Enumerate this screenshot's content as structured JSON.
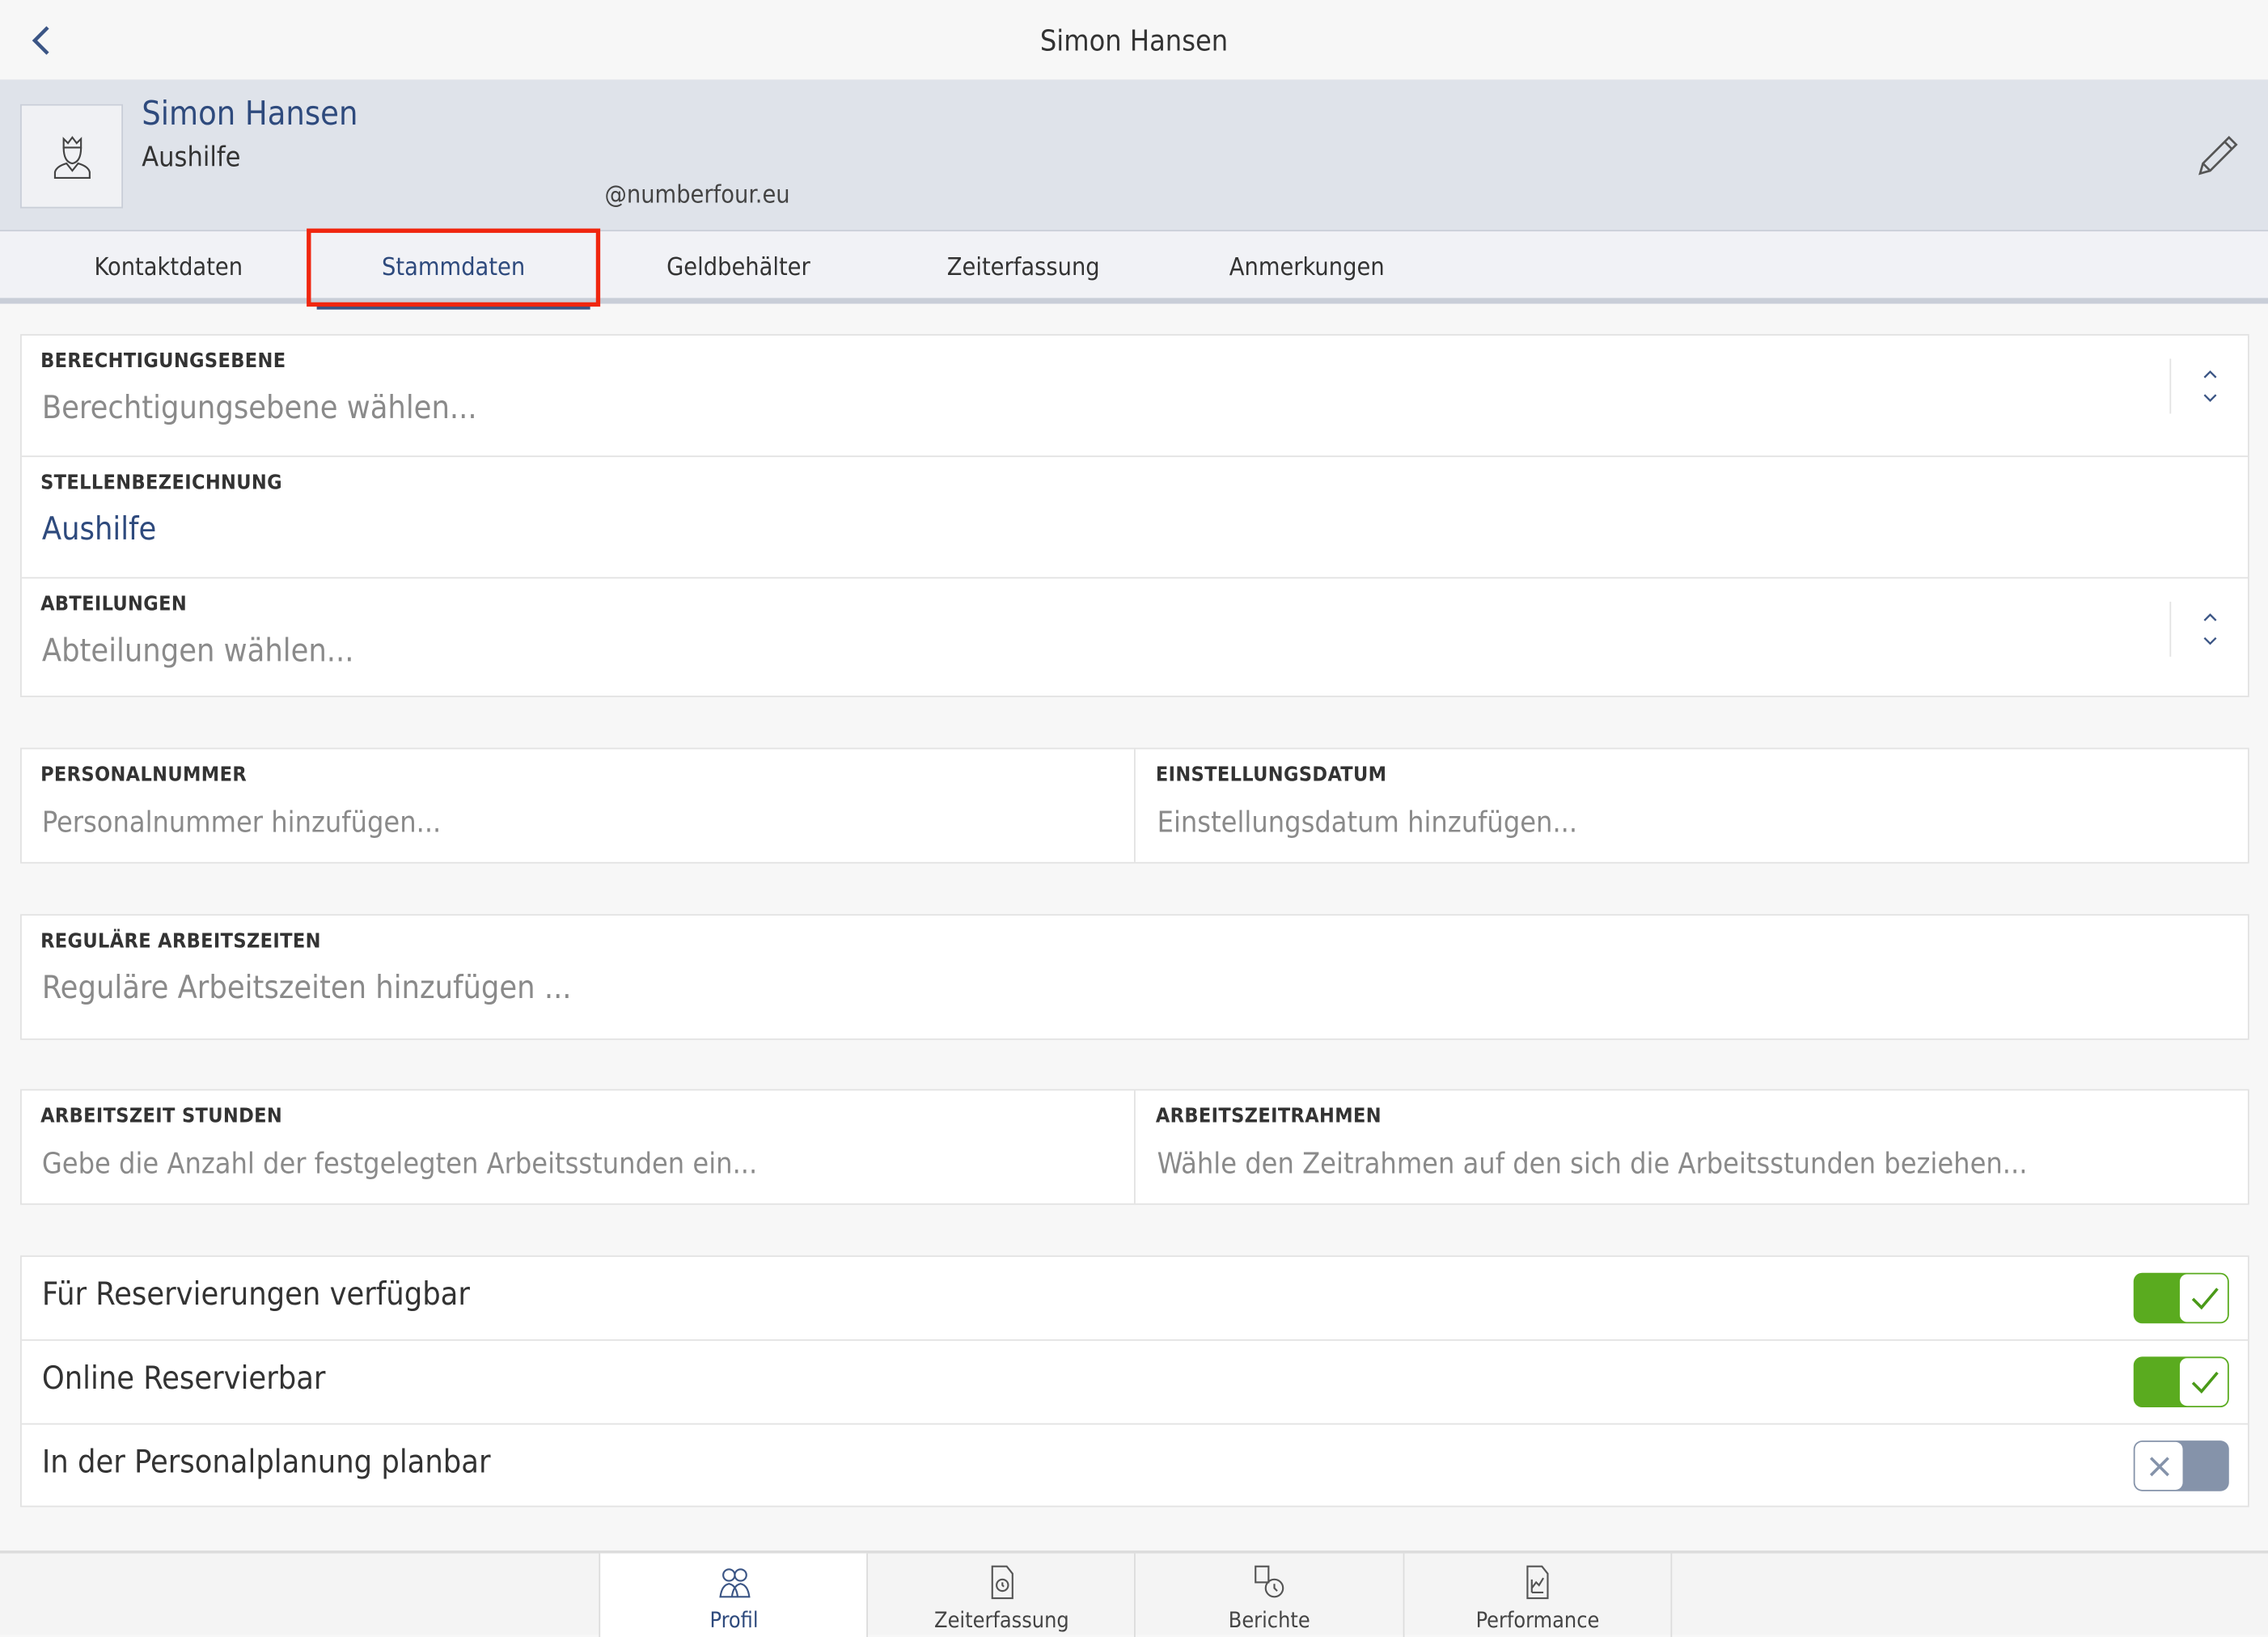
{
  "topbar": {
    "title": "Simon Hansen"
  },
  "profile": {
    "name": "Simon Hansen",
    "role": "Aushilfe",
    "email": "@numberfour.eu"
  },
  "tabs": [
    {
      "label": "Kontaktdaten",
      "active": false
    },
    {
      "label": "Stammdaten",
      "active": true
    },
    {
      "label": "Geldbehälter",
      "active": false
    },
    {
      "label": "Zeiterfassung",
      "active": false
    },
    {
      "label": "Anmerkungen",
      "active": false
    }
  ],
  "fields": {
    "berechtigungsebene": {
      "label": "BERECHTIGUNGSEBENE",
      "placeholder": "Berechtigungsebene wählen..."
    },
    "stellenbezeichnung": {
      "label": "STELLENBEZEICHNUNG",
      "value": "Aushilfe"
    },
    "abteilungen": {
      "label": "ABTEILUNGEN",
      "placeholder": "Abteilungen wählen..."
    },
    "personalnummer": {
      "label": "PERSONALNUMMER",
      "placeholder": "Personalnummer hinzufügen..."
    },
    "einstellungsdatum": {
      "label": "EINSTELLUNGSDATUM",
      "placeholder": "Einstellungsdatum hinzufügen..."
    },
    "arbeitszeiten": {
      "label": "REGULÄRE ARBEITSZEITEN",
      "placeholder": "Reguläre Arbeitszeiten hinzufügen ..."
    },
    "stunden": {
      "label": "ARBEITSZEIT STUNDEN",
      "placeholder": "Gebe die Anzahl der festgelegten Arbeitsstunden ein..."
    },
    "rahmen": {
      "label": "ARBEITSZEITRAHMEN",
      "placeholder": "Wähle den Zeitrahmen auf den sich die Arbeitsstunden beziehen..."
    }
  },
  "toggles": [
    {
      "label": "Für Reservierungen verfügbar",
      "on": true
    },
    {
      "label": "Online Reservierbar",
      "on": true
    },
    {
      "label": "In der Personalplanung planbar",
      "on": false
    }
  ],
  "colors": {
    "accent": "#2e4a7d",
    "toggle_on": "#5aab1f",
    "toggle_off": "#8593aa",
    "highlight": "#f0260f"
  },
  "bottom_nav": [
    {
      "label": "Profil",
      "icon": "people-icon",
      "active": true
    },
    {
      "label": "Zeiterfassung",
      "icon": "time-document-icon",
      "active": false
    },
    {
      "label": "Berichte",
      "icon": "reports-clock-icon",
      "active": false
    },
    {
      "label": "Performance",
      "icon": "chart-document-icon",
      "active": false
    }
  ]
}
